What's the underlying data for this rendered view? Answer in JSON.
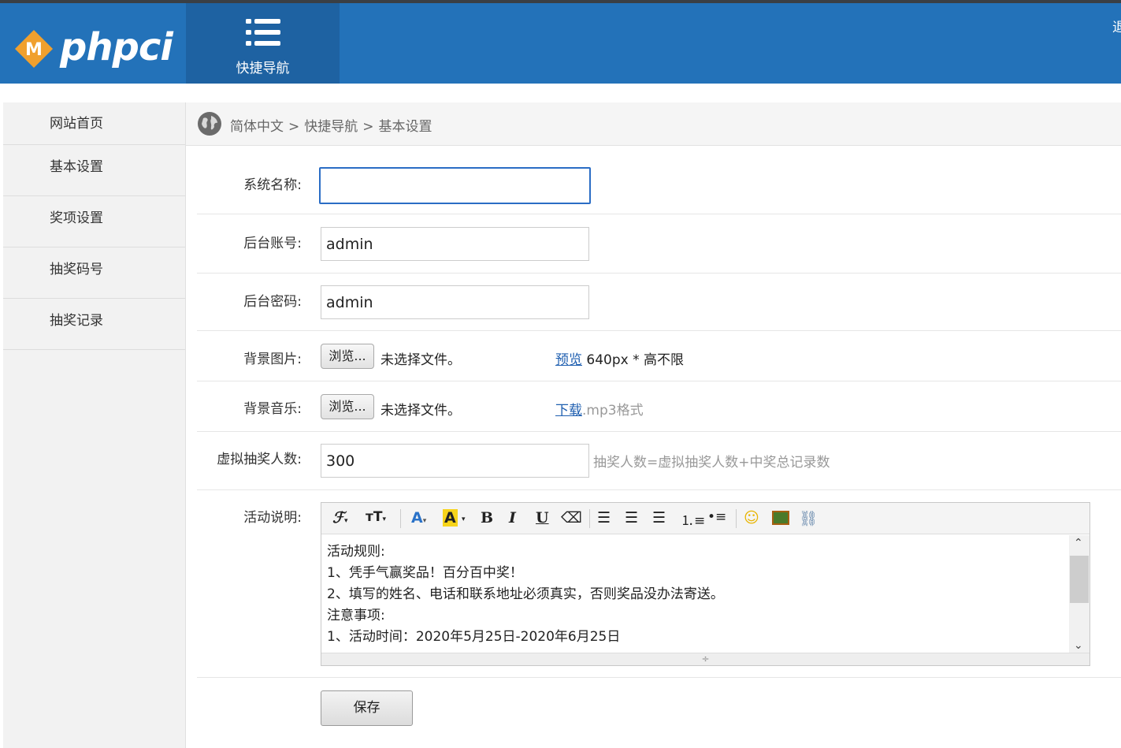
{
  "header": {
    "logo_text": "phpci",
    "logo_badge": "M",
    "quick_nav_label": "快捷导航",
    "logout_label": "退",
    "brand_color": "#2372b9",
    "nav_active_color": "#1e62a2",
    "logo_accent": "#f0a02e"
  },
  "sidebar": {
    "items": [
      {
        "label": "网站首页"
      },
      {
        "label": "基本设置"
      },
      {
        "label": "奖项设置"
      },
      {
        "label": "抽奖码号"
      },
      {
        "label": "抽奖记录"
      }
    ]
  },
  "breadcrumb": {
    "icon": "globe-icon",
    "items": [
      "简体中文",
      "快捷导航",
      "基本设置"
    ],
    "separator": ">"
  },
  "form": {
    "system_name": {
      "label": "系统名称:",
      "value": ""
    },
    "admin_account": {
      "label": "后台账号:",
      "value": "admin"
    },
    "admin_password": {
      "label": "后台密码:",
      "value": "admin"
    },
    "bg_image": {
      "label": "背景图片:",
      "browse": "浏览...",
      "no_file": "未选择文件。",
      "preview_link": "预览",
      "hint": "640px * 高不限"
    },
    "bg_music": {
      "label": "背景音乐:",
      "browse": "浏览...",
      "no_file": "未选择文件。",
      "download_link": "下载",
      "hint": ".mp3格式"
    },
    "virtual_count": {
      "label": "虚拟抽奖人数:",
      "value": "300",
      "hint": "抽奖人数=虚拟抽奖人数+中奖总记录数"
    },
    "description": {
      "label": "活动说明:",
      "lines": [
        "活动规则:",
        "1、凭手气赢奖品！百分百中奖！",
        "2、填写的姓名、电话和联系地址必须真实，否则奖品没办法寄送。",
        "注意事项:",
        "1、活动时间：2020年5月25日-2020年6月25日"
      ],
      "toolbar_icons": [
        "font-family-icon",
        "font-size-icon",
        "font-color-icon",
        "highlight-icon",
        "bold-icon",
        "italic-icon",
        "underline-icon",
        "eraser-icon",
        "align-left-icon",
        "align-center-icon",
        "align-right-icon",
        "ordered-list-icon",
        "unordered-list-icon",
        "emoji-icon",
        "image-icon",
        "link-icon"
      ]
    },
    "save_label": "保存"
  }
}
